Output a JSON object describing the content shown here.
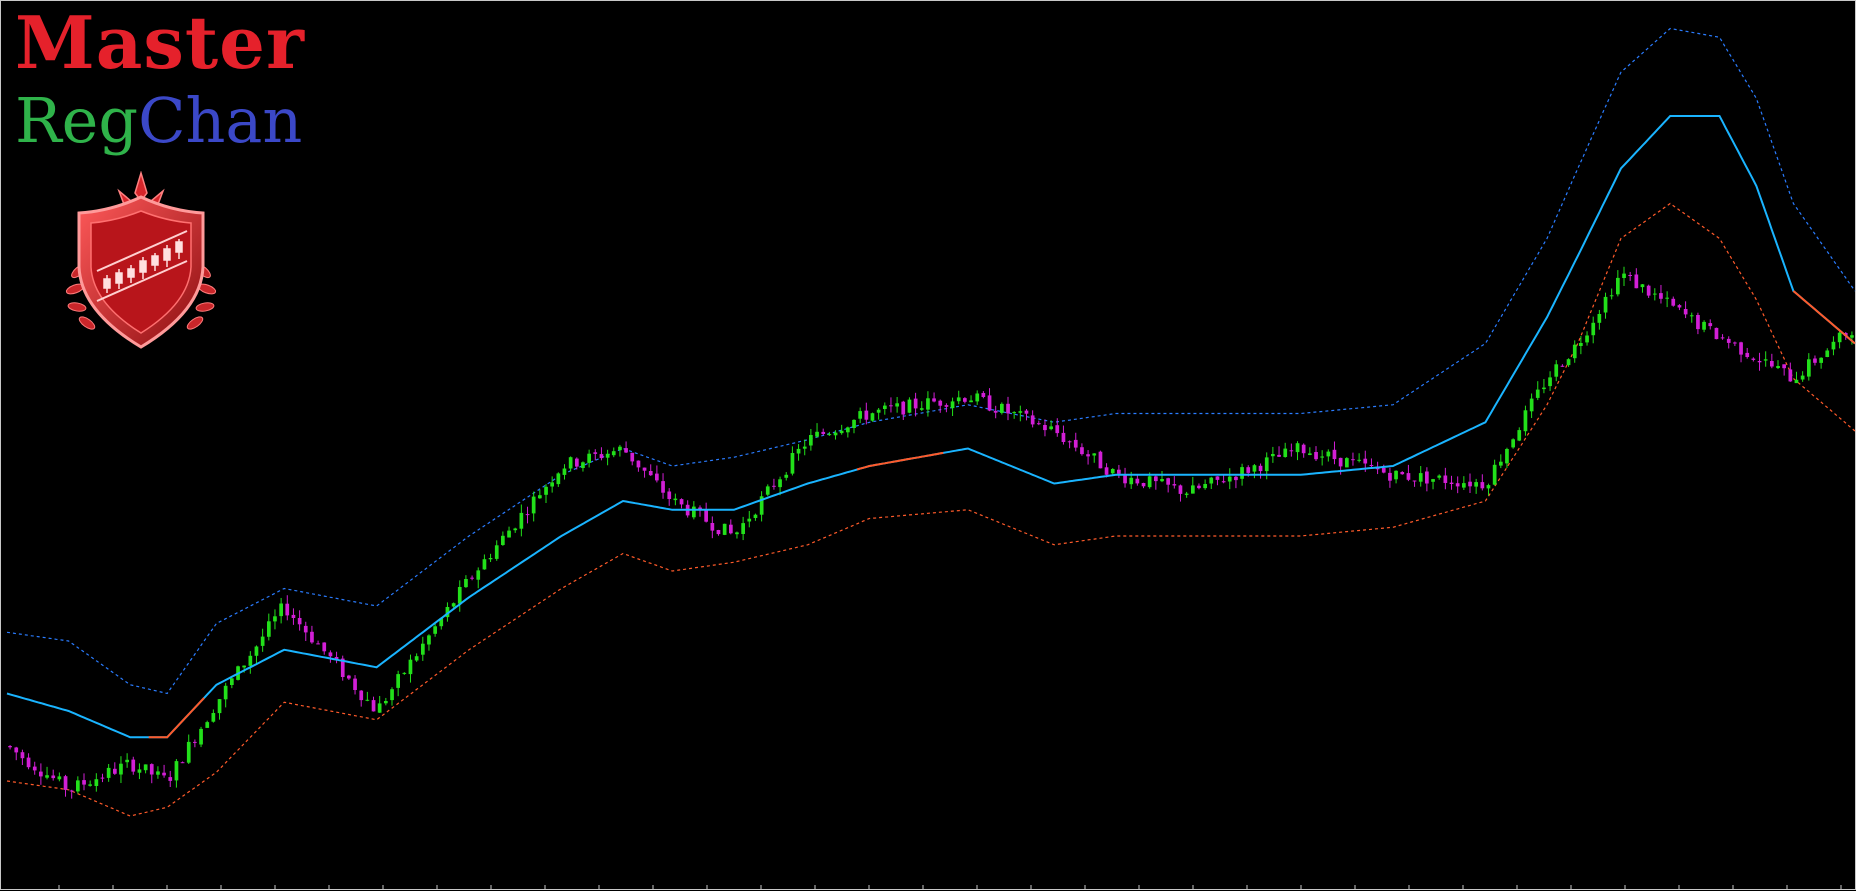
{
  "brand": {
    "title": "Master",
    "subtitle_part1": "Reg",
    "subtitle_part2": "Chan",
    "title_color": "#e5212b",
    "subtitle_part1_color": "#2fb34a",
    "subtitle_part2_color": "#3b48c8"
  },
  "logo": {
    "icon": "shield-candlestick-logo-icon",
    "color": "#d42a2a"
  },
  "colors": {
    "background": "#000000",
    "bull_candle": "#22e01a",
    "bear_candle": "#d21fd6",
    "center_line_up": "#1ab4ff",
    "center_line_down": "#ff5a2a",
    "upper_band": "#2a7cff",
    "lower_band": "#ff5a2a"
  },
  "chart_data": {
    "type": "candlestick",
    "title": "",
    "xlabel": "",
    "ylabel": "",
    "grid": false,
    "legend": "none",
    "n_bars": 300,
    "ylim": [
      0,
      100
    ],
    "series": [
      {
        "role": "price",
        "x": [
          0,
          10,
          20,
          26,
          34,
          45,
          60,
          75,
          90,
          100,
          108,
          118,
          130,
          140,
          156,
          170,
          180,
          192,
          210,
          225,
          240,
          250,
          255,
          262,
          275,
          290,
          300
        ],
        "y": [
          16,
          11,
          14,
          12,
          21,
          32,
          20,
          35,
          48,
          50,
          44,
          40,
          51,
          54,
          56,
          52,
          47,
          45,
          50,
          47,
          46,
          58,
          62,
          70,
          64,
          58,
          64
        ]
      },
      {
        "role": "center",
        "x": [
          0,
          10,
          20,
          26,
          34,
          45,
          60,
          75,
          90,
          100,
          108,
          118,
          130,
          140,
          156,
          170,
          180,
          192,
          210,
          225,
          240,
          250,
          255,
          262,
          270,
          278,
          284,
          290,
          300
        ],
        "y": [
          22,
          20,
          17,
          17,
          23,
          27,
          25,
          33,
          40,
          44,
          43,
          43,
          46,
          48,
          50,
          46,
          47,
          47,
          47,
          48,
          53,
          65,
          72,
          82,
          88,
          88,
          80,
          68,
          62
        ]
      },
      {
        "role": "upper",
        "x": [
          0,
          10,
          20,
          26,
          34,
          45,
          60,
          75,
          90,
          100,
          108,
          118,
          130,
          140,
          156,
          170,
          180,
          192,
          210,
          225,
          240,
          250,
          255,
          262,
          270,
          278,
          284,
          290,
          300
        ],
        "y": [
          29,
          28,
          23,
          22,
          30,
          34,
          32,
          40,
          47,
          50,
          48,
          49,
          51,
          53,
          55,
          53,
          54,
          54,
          54,
          55,
          62,
          74,
          82,
          93,
          98,
          97,
          90,
          78,
          68
        ]
      },
      {
        "role": "lower",
        "x": [
          0,
          10,
          20,
          26,
          34,
          45,
          60,
          75,
          90,
          100,
          108,
          118,
          130,
          140,
          156,
          170,
          180,
          192,
          210,
          225,
          240,
          250,
          255,
          262,
          270,
          278,
          284,
          290,
          300
        ],
        "y": [
          12,
          11,
          8,
          9,
          13,
          21,
          19,
          27,
          34,
          38,
          36,
          37,
          39,
          42,
          43,
          39,
          40,
          40,
          40,
          41,
          44,
          55,
          62,
          74,
          78,
          74,
          67,
          58,
          52
        ]
      }
    ],
    "center_down_segments": [
      [
        23,
        32
      ],
      [
        138,
        152
      ],
      [
        290,
        300
      ]
    ]
  }
}
